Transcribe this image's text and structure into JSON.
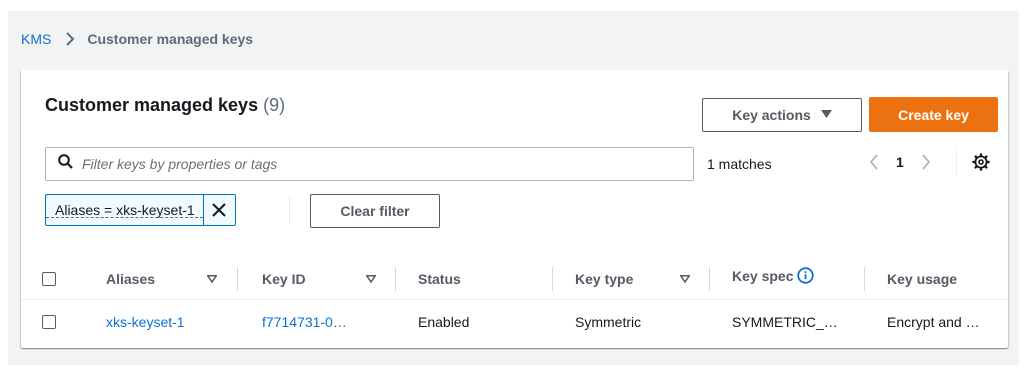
{
  "breadcrumb": {
    "root": "KMS",
    "current": "Customer managed keys"
  },
  "panel": {
    "title": "Customer managed keys",
    "count": "(9)"
  },
  "buttons": {
    "key_actions": "Key actions",
    "create_key": "Create key",
    "clear_filter": "Clear filter"
  },
  "search": {
    "placeholder": "Filter keys by properties or tags"
  },
  "filter_token": {
    "label": "Aliases = xks-keyset-1"
  },
  "results": {
    "matches": "1 matches"
  },
  "pagination": {
    "current_page": "1"
  },
  "table": {
    "headers": [
      "Aliases",
      "Key ID",
      "Status",
      "Key type",
      "Key spec",
      "Key usage"
    ],
    "rows": [
      {
        "alias": "xks-keyset-1",
        "key_id": "f7714731-0…",
        "status": "Enabled",
        "key_type": "Symmetric",
        "key_spec": "SYMMETRIC_…",
        "key_usage": "Encrypt and …"
      }
    ]
  },
  "colors": {
    "accent_link": "#0972d3",
    "primary_button": "#ec7211",
    "token_border": "#0073bb"
  }
}
